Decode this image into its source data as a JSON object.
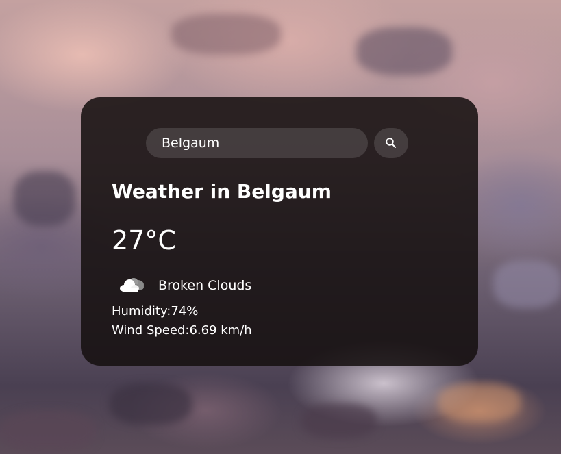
{
  "search": {
    "value": "Belgaum",
    "button_icon": "search-icon"
  },
  "weather": {
    "title": "Weather in Belgaum",
    "temperature": "27°C",
    "condition_icon": "broken-clouds-icon",
    "condition": "Broken Clouds",
    "humidity": "Humidity:74%",
    "wind": "Wind Speed:6.69 km/h"
  },
  "colors": {
    "card_background": "#161010",
    "text": "#ffffff"
  }
}
